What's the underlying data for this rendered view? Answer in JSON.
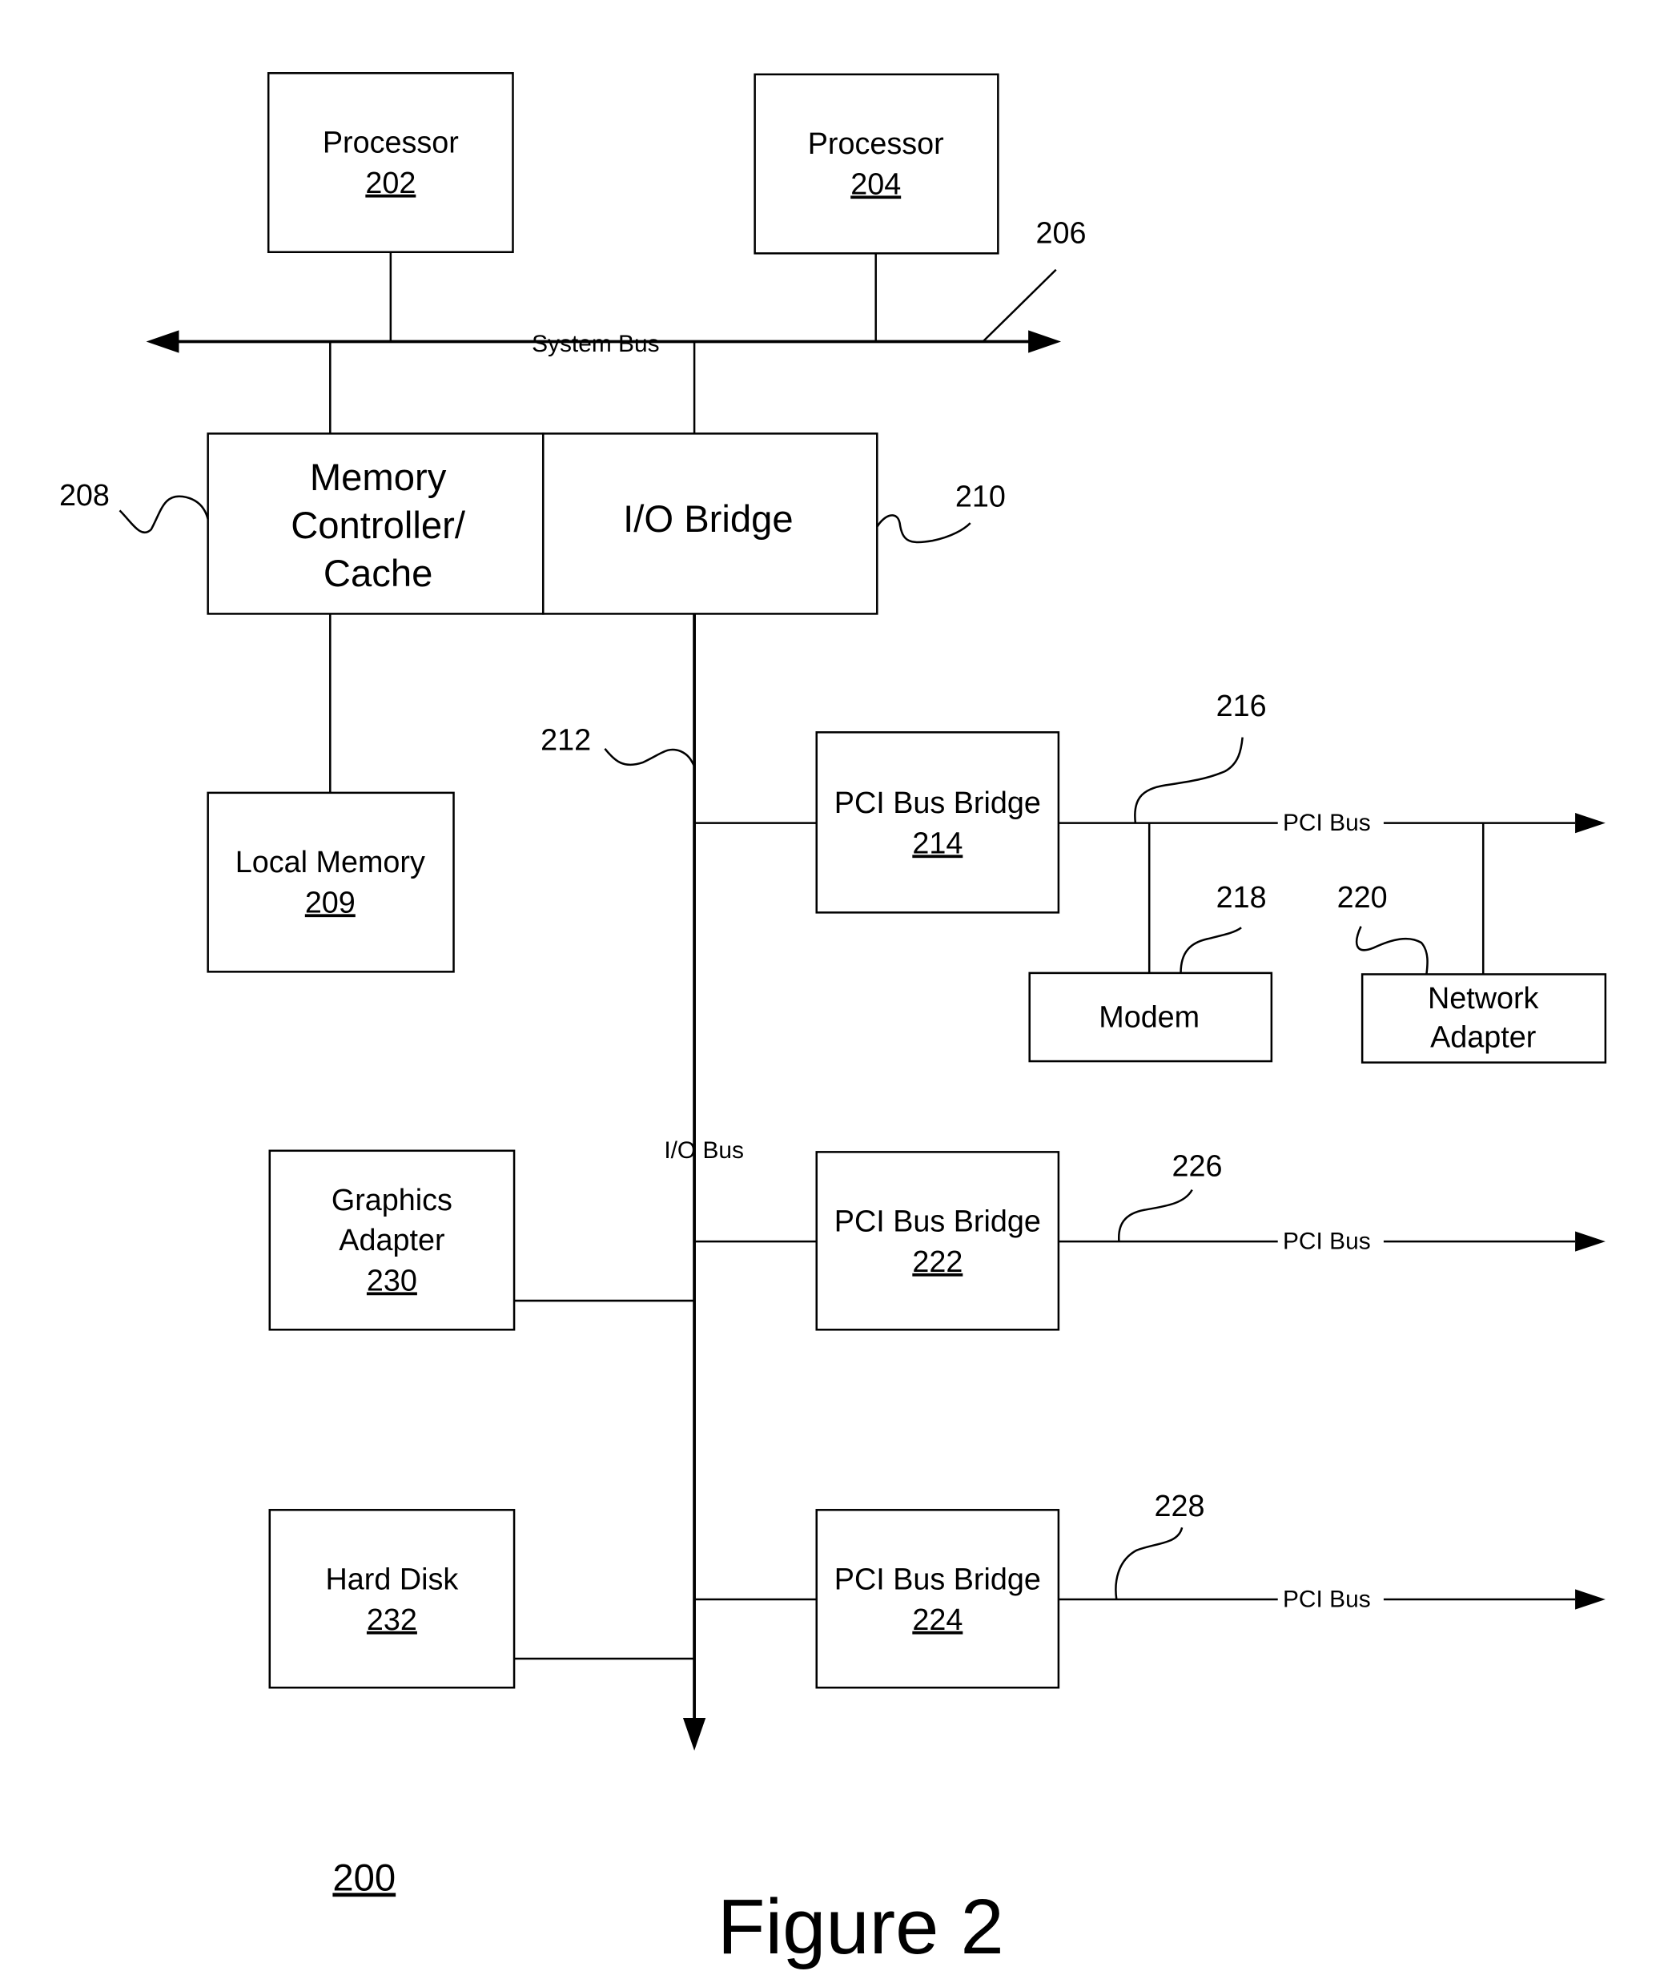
{
  "figure": {
    "title": "Figure 2",
    "reference": "200"
  },
  "components": {
    "processor_202": {
      "label": "Processor",
      "ref": "202"
    },
    "processor_204": {
      "label": "Processor",
      "ref": "204"
    },
    "memory_controller": {
      "lines": [
        "Memory",
        "Controller/",
        "Cache"
      ],
      "callout": "208"
    },
    "io_bridge": {
      "label": "I/O Bridge",
      "callout": "210"
    },
    "local_memory": {
      "label": "Local Memory",
      "ref": "209"
    },
    "pci_bridge_214": {
      "label": "PCI Bus Bridge",
      "ref": "214"
    },
    "pci_bridge_222": {
      "label": "PCI Bus Bridge",
      "ref": "222"
    },
    "pci_bridge_224": {
      "label": "PCI Bus Bridge",
      "ref": "224"
    },
    "modem": {
      "label": "Modem",
      "callout": "218"
    },
    "network_adapter": {
      "lines": [
        "Network",
        "Adapter"
      ],
      "callout": "220"
    },
    "graphics_adapter": {
      "lines": [
        "Graphics",
        "Adapter"
      ],
      "ref": "230"
    },
    "hard_disk": {
      "label": "Hard Disk",
      "ref": "232"
    }
  },
  "buses": {
    "system_bus": {
      "label": "System Bus",
      "callout": "206"
    },
    "io_bus": {
      "label": "I/O Bus",
      "callout": "212"
    },
    "pci_bus_1": {
      "label": "PCI Bus",
      "callout": "216"
    },
    "pci_bus_2": {
      "label": "PCI Bus",
      "callout": "226"
    },
    "pci_bus_3": {
      "label": "PCI Bus",
      "callout": "228"
    }
  }
}
